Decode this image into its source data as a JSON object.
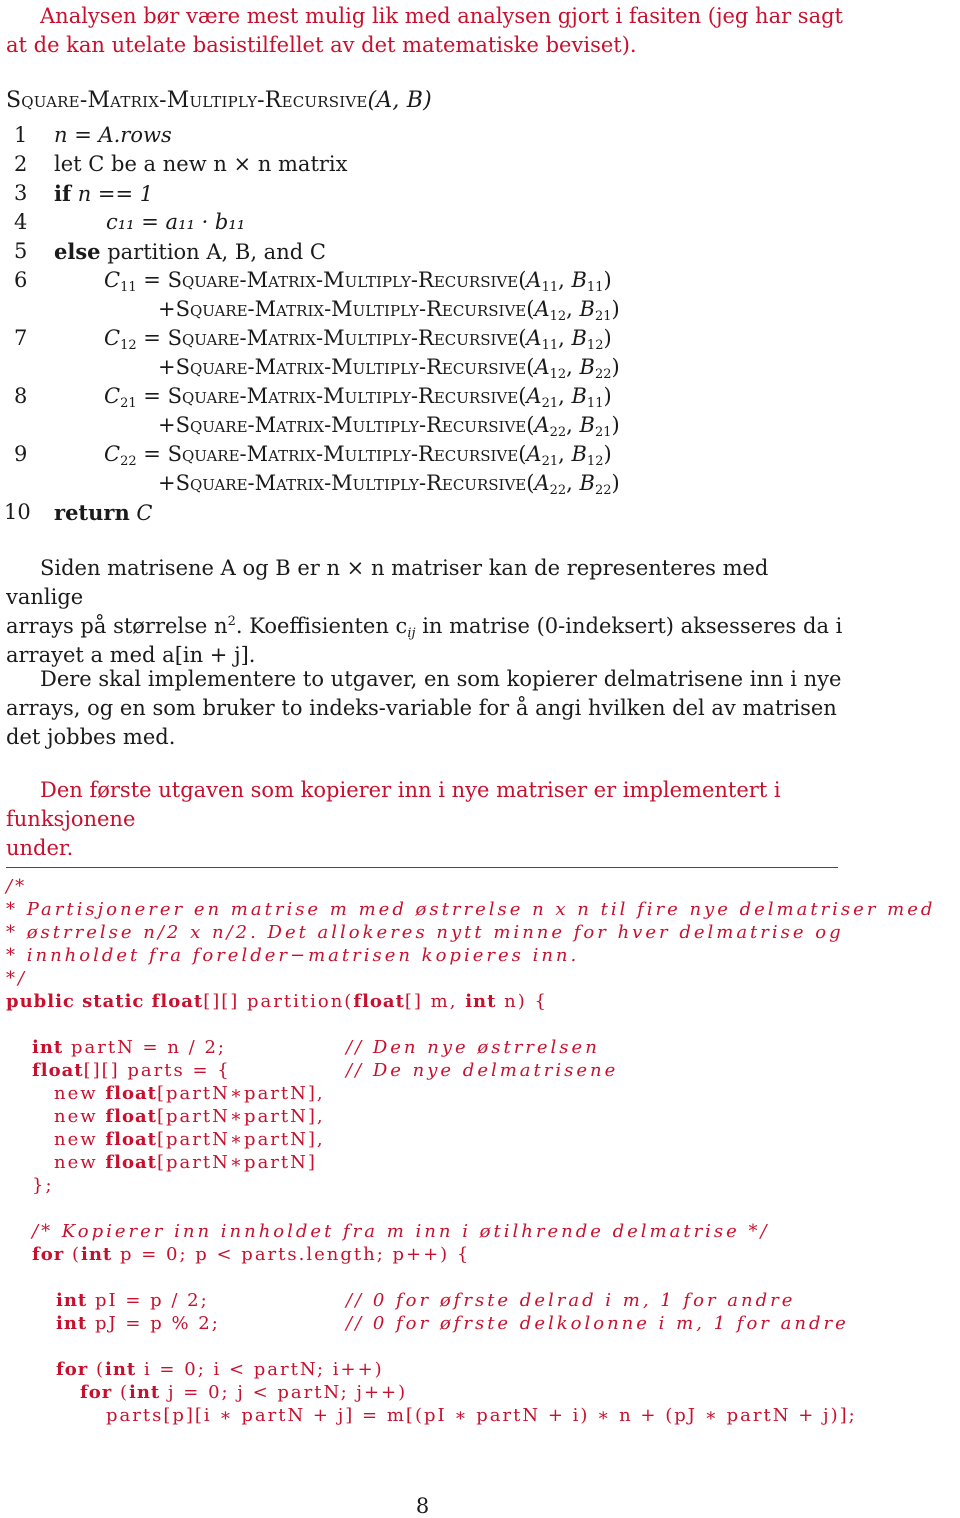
{
  "intro_note": {
    "line1": "Analysen bør være mest mulig lik med analysen gjort i fasiten (jeg har sagt",
    "line2": "at de kan utelate basistilfellet av det matematiske beviset)."
  },
  "algorithm": {
    "name": "Square-Matrix-Multiply-Recursive",
    "args": "(A, B)",
    "lines": [
      {
        "num": "1",
        "text": "n = A.rows"
      },
      {
        "num": "2",
        "text": "let C be a new n × n matrix"
      },
      {
        "num": "3",
        "keyword": "if",
        "text": "n == 1"
      },
      {
        "num": "4",
        "text": "c₁₁ = a₁₁ · b₁₁"
      },
      {
        "num": "5",
        "keyword": "else",
        "text": "partition A, B, and C"
      },
      {
        "num": "6",
        "lhs": "C",
        "lhs_sub": "11",
        "call1": [
          "11",
          "11"
        ],
        "call2": [
          "12",
          "21"
        ]
      },
      {
        "num": "7",
        "lhs": "C",
        "lhs_sub": "12",
        "call1": [
          "11",
          "12"
        ],
        "call2": [
          "12",
          "22"
        ]
      },
      {
        "num": "8",
        "lhs": "C",
        "lhs_sub": "21",
        "call1": [
          "21",
          "11"
        ],
        "call2": [
          "22",
          "21"
        ]
      },
      {
        "num": "9",
        "lhs": "C",
        "lhs_sub": "22",
        "call1": [
          "21",
          "12"
        ],
        "call2": [
          "22",
          "22"
        ]
      },
      {
        "num": "10",
        "keyword": "return",
        "text": "C"
      }
    ]
  },
  "para1": {
    "l1": "Siden matrisene A og B er n × n matriser kan de representeres med vanlige",
    "l2a": "arrays på størrelse n",
    "l2sup": "2",
    "l2b": ". Koeffisienten c",
    "l2sub": "ij",
    "l2c": " in matrise (0-indeksert) aksesseres da i",
    "l3": "arrayet a med a[in + j]."
  },
  "para2": {
    "l1": "Dere skal implementere to utgaver, en som kopierer delmatrisene inn i nye",
    "l2": "arrays, og en som bruker to indeks-variable for å angi hvilken del av matrisen",
    "l3": "det jobbes med."
  },
  "para3": {
    "l1": "Den første utgaven som kopierer inn i nye matriser er implementert i funksjonene",
    "l2": "under."
  },
  "code": [
    {
      "text": "/*",
      "type": "comment"
    },
    {
      "text": "* Partisjonerer en matrise m med østrrelse n x n til fire nye delmatriser med",
      "type": "comment"
    },
    {
      "text": "* østrrelse n/2 x n/2. Det allokeres nytt minne for hver delmatrise og",
      "type": "comment"
    },
    {
      "text": "* innholdet fra forelder−matrisen kopieres inn.",
      "type": "comment"
    },
    {
      "text": "*/",
      "type": "comment"
    },
    {
      "kw": "public static float",
      "rest": "[][] partition(",
      "kw2": "float",
      "rest2": "[] m, ",
      "kw3": "int",
      "rest3": " n) {"
    },
    {
      "kw": "int",
      "rest": " partN = n / 2;",
      "comment": "// Den nye østrrelsen"
    },
    {
      "kw": "float",
      "rest": "[][] parts = {",
      "comment": "// De nye delmatrisene"
    },
    {
      "pre": "new ",
      "kw": "float",
      "rest": "[partN∗partN],"
    },
    {
      "pre": "new ",
      "kw": "float",
      "rest": "[partN∗partN],"
    },
    {
      "pre": "new ",
      "kw": "float",
      "rest": "[partN∗partN],"
    },
    {
      "pre": "new ",
      "kw": "float",
      "rest": "[partN∗partN]"
    },
    {
      "rest": "};"
    },
    {
      "comment": "/* Kopierer inn innholdet fra m inn i øtilhrende delmatrise */"
    },
    {
      "kw": "for",
      "rest": " (",
      "kw2": "int",
      "rest2": " p = 0; p < parts.length; p++) {"
    },
    {
      "kw": "int",
      "rest": " pI = p / 2;",
      "comment": "// 0 for øfrste delrad i m, 1 for andre"
    },
    {
      "kw": "int",
      "rest": " pJ = p % 2;",
      "comment": "// 0 for øfrste delkolonne i m, 1 for andre"
    },
    {
      "kw": "for",
      "rest": " (",
      "kw2": "int",
      "rest2": " i = 0; i < partN; i++)"
    },
    {
      "kw": "for",
      "rest": " (",
      "kw2": "int",
      "rest2": " j = 0; j < partN; j++)"
    },
    {
      "rest": "parts[p][i ∗ partN + j] = m[(pI ∗ partN + i) ∗ n + (pJ ∗ partN + j)];"
    }
  ],
  "page_number": "8"
}
